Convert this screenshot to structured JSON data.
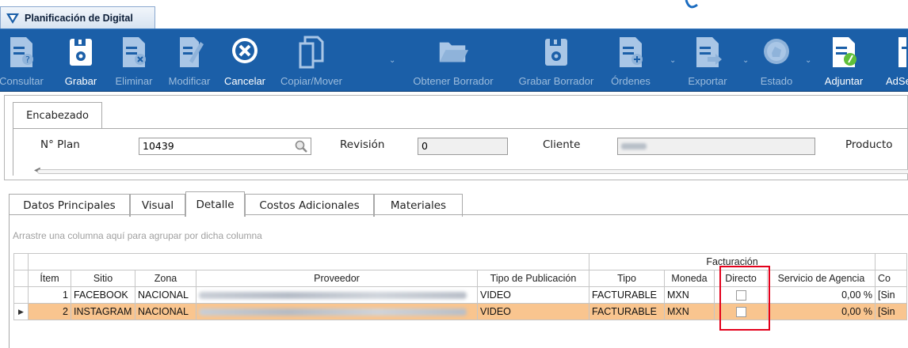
{
  "window": {
    "tab_title": "Planificación de Digital"
  },
  "toolbar": {
    "buttons": [
      {
        "label": "Consultar",
        "icon": "document-query-icon",
        "enabled": false
      },
      {
        "label": "Grabar",
        "icon": "save-disk-icon",
        "enabled": true
      },
      {
        "label": "Eliminar",
        "icon": "document-delete-icon",
        "enabled": false
      },
      {
        "label": "Modificar",
        "icon": "document-edit-icon",
        "enabled": false
      },
      {
        "label": "Cancelar",
        "icon": "cancel-circle-icon",
        "enabled": true
      },
      {
        "label": "Copiar/Mover",
        "icon": "copy-pages-icon",
        "enabled": false
      },
      {
        "label": "Obtener Borrador",
        "icon": "open-folder-icon",
        "enabled": false
      },
      {
        "label": "Grabar Borrador",
        "icon": "save-draft-icon",
        "enabled": false
      },
      {
        "label": "Órdenes",
        "icon": "document-add-icon",
        "enabled": false
      },
      {
        "label": "Exportar",
        "icon": "document-export-icon",
        "enabled": false
      },
      {
        "label": "Estado",
        "icon": "status-circle-icon",
        "enabled": false
      },
      {
        "label": "Adjuntar",
        "icon": "attach-document-icon",
        "enabled": true
      },
      {
        "label": "AdSe",
        "icon": "document-icon",
        "enabled": true
      }
    ]
  },
  "header": {
    "tab_label": "Encabezado",
    "plan_label": "N° Plan",
    "plan_value": "10439",
    "revision_label": "Revisión",
    "revision_value": "0",
    "cliente_label": "Cliente",
    "producto_label": "Producto"
  },
  "detail_tabs": [
    {
      "label": "Datos Principales",
      "active": false
    },
    {
      "label": "Visual",
      "active": false
    },
    {
      "label": "Detalle",
      "active": true
    },
    {
      "label": "Costos Adicionales",
      "active": false
    },
    {
      "label": "Materiales",
      "active": false
    }
  ],
  "grid": {
    "group_hint": "Arrastre una columna aquí para agrupar por dicha columna",
    "band_label": "Facturación",
    "columns": [
      "Ítem",
      "Sitio",
      "Zona",
      "Proveedor",
      "Tipo de Publicación",
      "Tipo",
      "Moneda",
      "Directo",
      "Servicio de Agencia",
      "Co"
    ],
    "rows": [
      {
        "item": "1",
        "sitio": "FACEBOOK",
        "zona": "NACIONAL",
        "tipo_publicacion": "VIDEO",
        "tipo": "FACTURABLE",
        "moneda": "MXN",
        "directo": false,
        "servicio": "0,00 %",
        "co": "[Sin",
        "selected": false
      },
      {
        "item": "2",
        "sitio": "INSTAGRAM",
        "zona": "NACIONAL",
        "tipo_publicacion": "VIDEO",
        "tipo": "FACTURABLE",
        "moneda": "MXN",
        "directo": false,
        "servicio": "0,00 %",
        "co": "[Sin",
        "selected": true
      }
    ]
  },
  "colors": {
    "toolbar_bg": "#1b5fa8",
    "selected_row": "#f9c58f",
    "highlight_box": "#e3001b"
  }
}
